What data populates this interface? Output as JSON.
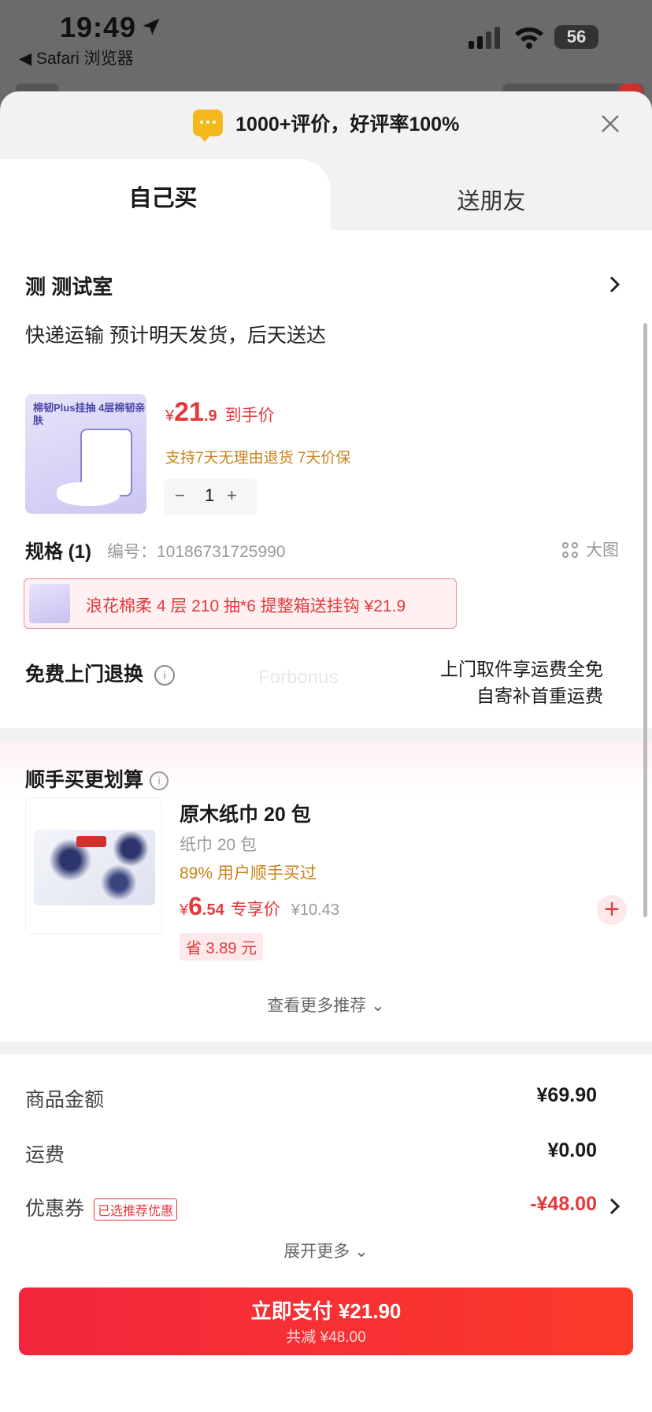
{
  "status": {
    "time": "19:49",
    "back": "◀ Safari 浏览器",
    "battery": "56"
  },
  "header": {
    "reviews": "1000+评价，好评率100%"
  },
  "tabs": {
    "self": "自己买",
    "gift": "送朋友"
  },
  "address": {
    "name": "测  测试室",
    "shipping": "快递运输 预计明天发货，后天送达"
  },
  "product": {
    "thumb_text": "棉韧Plus挂抽 4层棉韧亲肤",
    "price_symbol": "¥",
    "price_int": "21",
    "price_dec": ".9",
    "price_label": "到手价",
    "policy": "支持7天无理由退货  7天价保",
    "qty": "1",
    "qty_minus": "−",
    "qty_plus": "+",
    "spec": "规格 (1)",
    "sku": "编号：10186731725990",
    "big_pic": "大图",
    "variant": "浪花棉柔 4 层 210 抽*6 提整箱送挂钩   ¥21.9",
    "return_title": "免费上门退换",
    "return_line1": "上门取件享运费全免",
    "return_line2": "自寄补首重运费",
    "watermark": "Forbonus"
  },
  "recommend": {
    "title": "顺手买更划算",
    "name": "原木纸巾 20 包",
    "sub": "纸巾 20 包",
    "pct": "89% 用户顺手买过",
    "price_symbol": "¥",
    "price_int": "6",
    "price_dec": ".54",
    "price_label": "专享价",
    "orig": "¥10.43",
    "save": "省 3.89 元",
    "more": "查看更多推荐 ⌄"
  },
  "summary": {
    "goods_label": "商品金额",
    "goods": "¥69.90",
    "freight_label": "运费",
    "freight": "¥0.00",
    "coupon_label": "优惠券",
    "coupon_tag": "已选推荐优惠",
    "coupon": "-¥48.00",
    "expand": "展开更多 ⌄",
    "pay": "立即支付 ¥21.90",
    "pay_sub": "共减 ¥48.00"
  }
}
